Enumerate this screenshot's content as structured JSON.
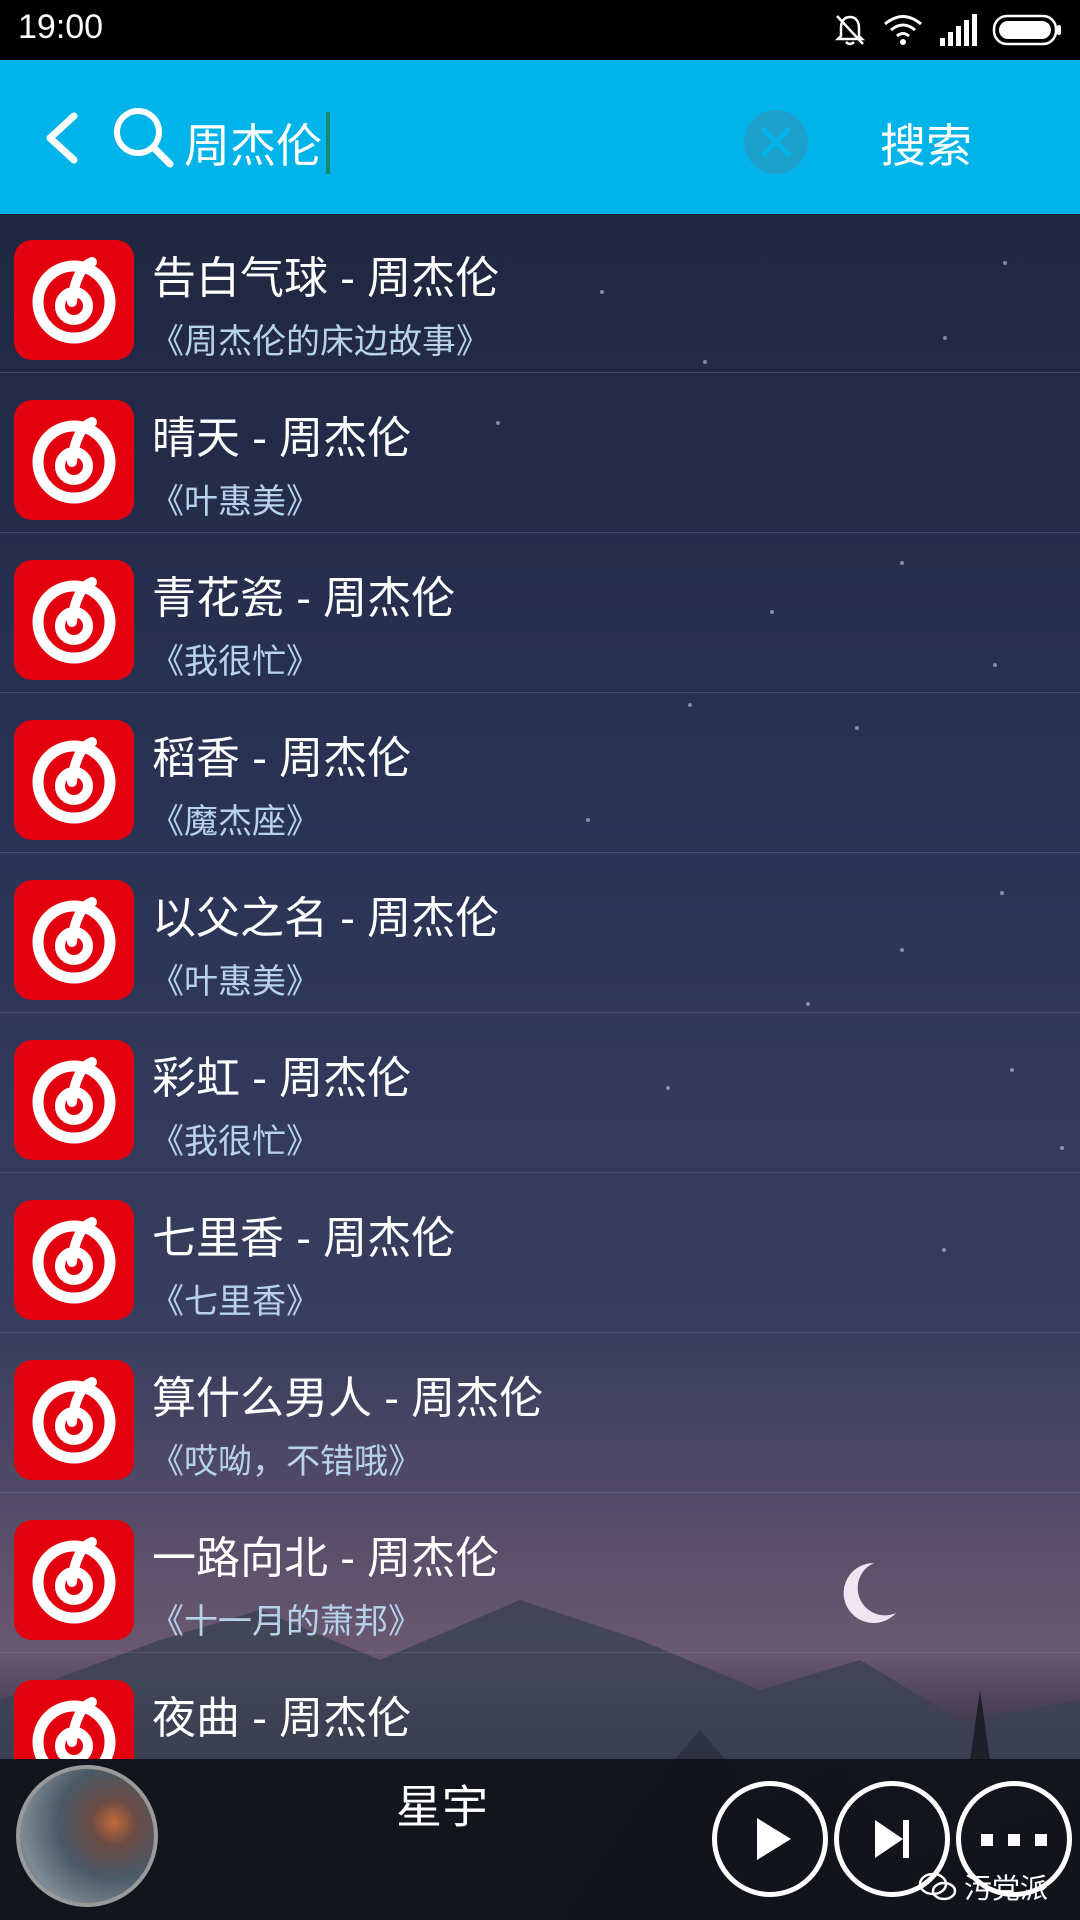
{
  "status_bar": {
    "time": "19:00"
  },
  "search": {
    "query": "周杰伦",
    "search_button_label": "搜索"
  },
  "results": [
    {
      "title": "告白气球 - 周杰伦",
      "album": "《周杰伦的床边故事》"
    },
    {
      "title": "晴天 - 周杰伦",
      "album": "《叶惠美》"
    },
    {
      "title": "青花瓷 - 周杰伦",
      "album": "《我很忙》"
    },
    {
      "title": "稻香 - 周杰伦",
      "album": "《魔杰座》"
    },
    {
      "title": "以父之名 - 周杰伦",
      "album": "《叶惠美》"
    },
    {
      "title": "彩虹 - 周杰伦",
      "album": "《我很忙》"
    },
    {
      "title": "七里香 - 周杰伦",
      "album": "《七里香》"
    },
    {
      "title": "算什么男人 - 周杰伦",
      "album": "《哎呦，不错哦》"
    },
    {
      "title": "一路向北 - 周杰伦",
      "album": "《十一月的萧邦》"
    },
    {
      "title": "夜曲 - 周杰伦",
      "album": ""
    }
  ],
  "result_icon": "netease-cloud-music-icon",
  "player": {
    "song_title": "星宇"
  },
  "watermark": "污党派",
  "colors": {
    "header": "#00b4ea",
    "result_icon": "#e3000f",
    "album_text": "#b7d3ec"
  }
}
